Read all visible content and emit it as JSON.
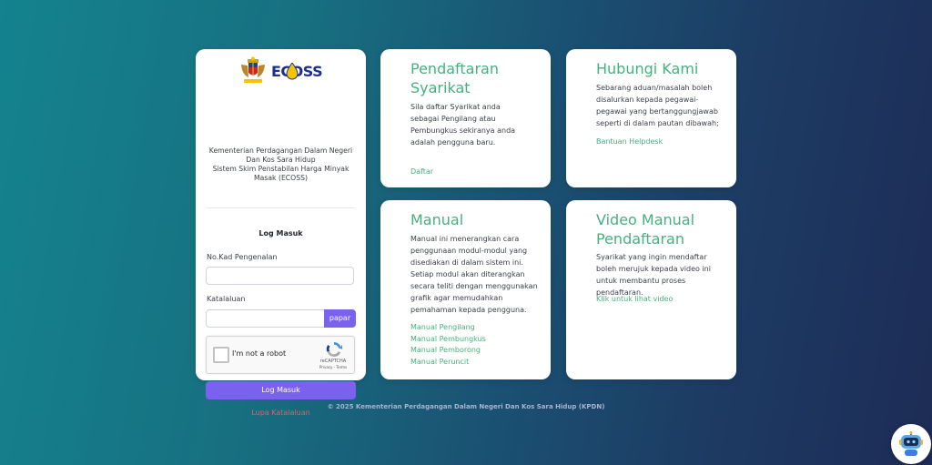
{
  "login": {
    "logo_text": "ECOSS",
    "ministry_line1": "Kementerian Perdagangan Dalam Negeri Dan Kos Sara Hidup",
    "ministry_line2": "Sistem Skim Penstabilan Harga Minyak Masak (ECOSS)",
    "title": "Log Masuk",
    "id_label": "No.Kad Pengenalan",
    "id_value": "",
    "password_label": "Katalaluan",
    "password_value": "",
    "show_password_button": "papar",
    "recaptcha": {
      "label": "I'm not a robot",
      "brand": "reCAPTCHA",
      "terms": "Privacy - Terms"
    },
    "submit_button": "Log Masuk",
    "forgot_link": "Lupa Katalaluan"
  },
  "cards": {
    "daftar": {
      "title": "Pendaftaran Syarikat",
      "body": "Sila daftar Syarikat anda sebagai Pengilang atau Pembungkus sekiranya anda adalah pengguna baru.",
      "link": "Daftar"
    },
    "hubungi": {
      "title": "Hubungi Kami",
      "body": "Sebarang aduan/masalah boleh disalurkan kepada pegawai-pegawai yang bertanggungjawab seperti di dalam pautan dibawah;",
      "link": "Bantuan Helpdesk"
    },
    "manual": {
      "title": "Manual",
      "body": "Manual ini menerangkan cara penggunaan modul-modul yang disediakan di dalam sistem ini. Setiap modul akan diterangkan secara teliti dengan menggunakan grafik agar memudahkan pemahaman kepada pengguna.",
      "links": [
        "Manual Pengilang",
        "Manual Pembungkus",
        "Manual Pemborong",
        "Manual Peruncit"
      ]
    },
    "video": {
      "title": "Video Manual Pendaftaran",
      "body": "Syarikat yang ingin mendaftar boleh merujuk kepada video ini untuk membantu proses pendaftaran.",
      "link": "Klik untuk lihat video"
    }
  },
  "footer": "© 2025 Kementerian Perdagangan Dalam Negeri Dan Kos Sara Hidup (KPDN)",
  "icons": {
    "crest": "malaysia-coat-of-arms-icon",
    "chatbot": "chatbot-robot-icon"
  },
  "colors": {
    "accent_purple": "#7a62ee",
    "link_green": "#45b17f",
    "danger_red": "#e35d6a"
  }
}
